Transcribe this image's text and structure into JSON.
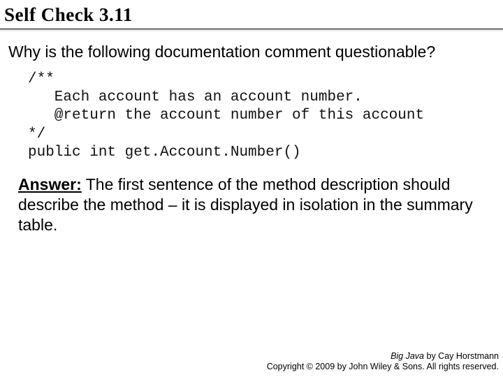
{
  "title": "Self Check 3.11",
  "question": "Why is the following documentation comment questionable?",
  "code": "/**\n   Each account has an account number.\n   @return the account number of this account\n*/\npublic int get.Account.Number()",
  "answer": {
    "label": "Answer:",
    "text": " The first sentence of the method description should describe the method – it is displayed in isolation in the summary table."
  },
  "footer": {
    "book": "Big Java",
    "by": " by Cay Horstmann",
    "copyright": "Copyright © 2009 by John Wiley & Sons. All rights reserved."
  }
}
